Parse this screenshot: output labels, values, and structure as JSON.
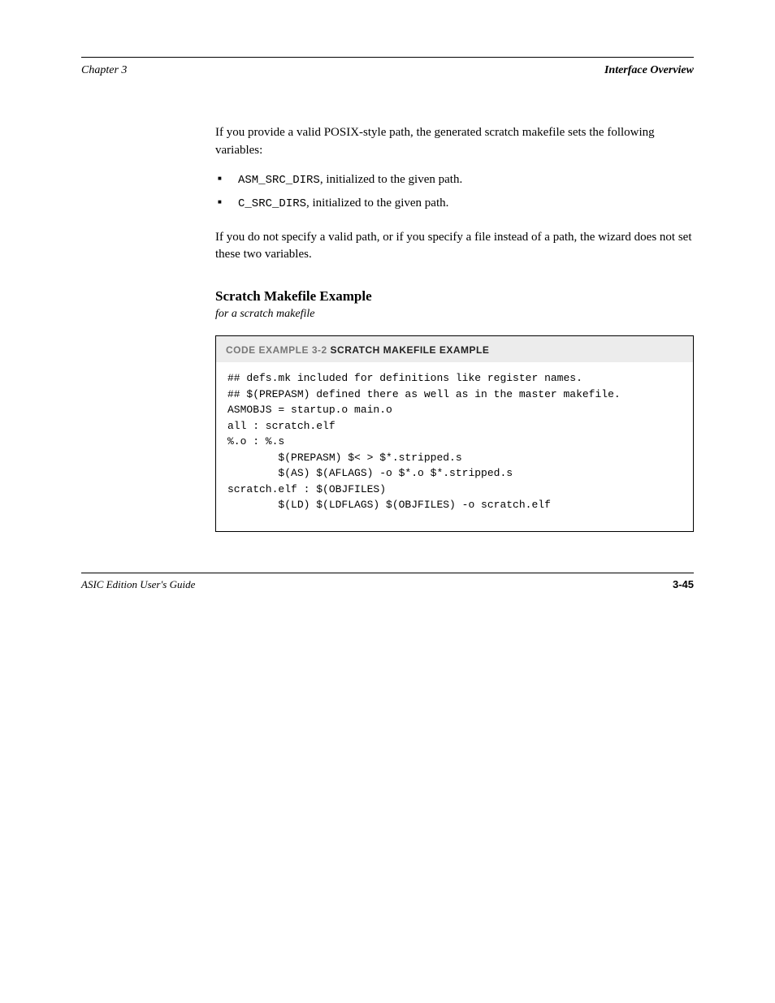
{
  "header": {
    "left": "Chapter 3",
    "right": "Interface Overview"
  },
  "body": {
    "intro": "If you provide a valid POSIX-style path, the generated scratch makefile sets the following variables:",
    "bullets": [
      {
        "var": "ASM_SRC_DIRS",
        "rest": ", initialized to the given path."
      },
      {
        "var": "C_SRC_DIRS",
        "rest": ", initialized to the given path."
      }
    ],
    "outro": "If you do not specify a valid path, or if you specify a file instead of a path, the wizard does not set these two variables."
  },
  "section": {
    "title": "Scratch Makefile Example",
    "subtitle": "for a scratch makefile"
  },
  "example": {
    "caption_prefix": "CODE EXAMPLE 3-2",
    "caption_main": "Scratch Makefile Example",
    "code": "## defs.mk included for definitions like register names.\n## $(PREPASM) defined there as well as in the master makefile.\nASMOBJS = startup.o main.o\nall : scratch.elf\n%.o : %.s\n        $(PREPASM) $< > $*.stripped.s\n        $(AS) $(AFLAGS) -o $*.o $*.stripped.s\nscratch.elf : $(OBJFILES)\n        $(LD) $(LDFLAGS) $(OBJFILES) -o scratch.elf"
  },
  "footer": {
    "left": "ASIC Edition User's Guide",
    "page": "3-45"
  }
}
